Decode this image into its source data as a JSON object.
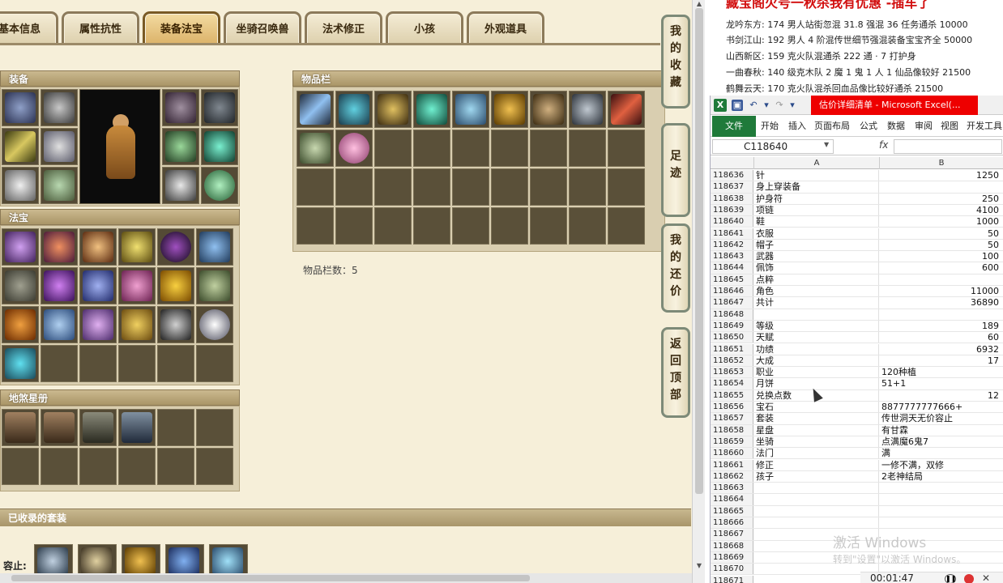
{
  "tabs": [
    {
      "label": "基本信息",
      "active": false
    },
    {
      "label": "属性抗性",
      "active": false
    },
    {
      "label": "装备法宝",
      "active": true
    },
    {
      "label": "坐骑召唤兽",
      "active": false
    },
    {
      "label": "法术修正",
      "active": false
    },
    {
      "label": "小孩",
      "active": false
    },
    {
      "label": "外观道具",
      "active": false
    }
  ],
  "panels": {
    "equipment": "装备",
    "treasure": "法宝",
    "star_album": "地煞星册",
    "inventory": "物品栏",
    "inventory_count": "物品栏数：5",
    "collected_sets": "已收录的套装",
    "contain_label": "容止:"
  },
  "side_buttons": [
    {
      "label": "我的收藏"
    },
    {
      "label": "足迹"
    },
    {
      "label": "我的还价"
    },
    {
      "label": "返回顶部"
    }
  ],
  "news": {
    "title": "藏宝阁火号一秋杀我有优惠 -插车了",
    "lines": [
      "龙吟东方: 174 男人站街忽混 31.8 强混 36 任务通杀 10000",
      "书剑江山: 192 男人 4 阶混传世细节强混装备宝宝齐全 50000",
      "山西新区: 159 克火队混通杀 222 通 · 7 打护身",
      "一曲春秋: 140 级克木队 2 魔 1 鬼 1 人 1 仙品像较好 21500",
      "鹤舞云天: 170 克火队混杀回血品像比较好通杀 21500"
    ]
  },
  "excel": {
    "logo": "X",
    "title": "估价详细清单 - Microsoft Excel(...",
    "ribbon_tabs": [
      "文件",
      "开始",
      "插入",
      "页面布局",
      "公式",
      "数据",
      "审阅",
      "视图",
      "开发工具"
    ],
    "name_box": "C118640",
    "fx": "fx",
    "columns": [
      "A",
      "B"
    ],
    "rows": [
      {
        "n": "118636",
        "a": "针",
        "b": "1250",
        "num": true
      },
      {
        "n": "118637",
        "a": "身上穿装备",
        "b": "",
        "num": false
      },
      {
        "n": "118638",
        "a": "护身符",
        "b": "250",
        "num": true
      },
      {
        "n": "118639",
        "a": "项链",
        "b": "4100",
        "num": true
      },
      {
        "n": "118640",
        "a": "鞋",
        "b": "1000",
        "num": true
      },
      {
        "n": "118641",
        "a": "衣服",
        "b": "50",
        "num": true
      },
      {
        "n": "118642",
        "a": "帽子",
        "b": "50",
        "num": true
      },
      {
        "n": "118643",
        "a": "武器",
        "b": "100",
        "num": true
      },
      {
        "n": "118644",
        "a": "佩饰",
        "b": "600",
        "num": true
      },
      {
        "n": "118645",
        "a": "点粹",
        "b": "",
        "num": false
      },
      {
        "n": "118646",
        "a": "角色",
        "b": "11000",
        "num": true
      },
      {
        "n": "118647",
        "a": "共计",
        "b": "36890",
        "num": true
      },
      {
        "n": "118648",
        "a": "",
        "b": "",
        "num": false
      },
      {
        "n": "118649",
        "a": "等级",
        "b": "189",
        "num": true
      },
      {
        "n": "118650",
        "a": "天赋",
        "b": "60",
        "num": true
      },
      {
        "n": "118651",
        "a": "功绩",
        "b": "6932",
        "num": true
      },
      {
        "n": "118652",
        "a": "大成",
        "b": "17",
        "num": true
      },
      {
        "n": "118653",
        "a": "职业",
        "b": "120种植",
        "num": false
      },
      {
        "n": "118654",
        "a": "月饼",
        "b": "51+1",
        "num": false
      },
      {
        "n": "118655",
        "a": "兑换点数",
        "b": "12",
        "num": true
      },
      {
        "n": "118656",
        "a": "宝石",
        "b": "8877777777666+",
        "num": false
      },
      {
        "n": "118657",
        "a": "套装",
        "b": "传世洞天无价容止",
        "num": false
      },
      {
        "n": "118658",
        "a": "星盘",
        "b": "有甘霖",
        "num": false
      },
      {
        "n": "118659",
        "a": "坐骑",
        "b": "点满魔6鬼7",
        "num": false
      },
      {
        "n": "118660",
        "a": "法门",
        "b": "满",
        "num": false
      },
      {
        "n": "118661",
        "a": "修正",
        "b": "一修不满，双修",
        "num": false
      },
      {
        "n": "118662",
        "a": "孩子",
        "b": "2老神结局",
        "num": false
      },
      {
        "n": "118663",
        "a": "",
        "b": "",
        "num": false
      },
      {
        "n": "118664",
        "a": "",
        "b": "",
        "num": false
      },
      {
        "n": "118665",
        "a": "",
        "b": "",
        "num": false
      },
      {
        "n": "118666",
        "a": "",
        "b": "",
        "num": false
      },
      {
        "n": "118667",
        "a": "",
        "b": "",
        "num": false
      },
      {
        "n": "118668",
        "a": "",
        "b": "",
        "num": false
      },
      {
        "n": "118669",
        "a": "",
        "b": "",
        "num": false
      },
      {
        "n": "118670",
        "a": "",
        "b": "",
        "num": false
      },
      {
        "n": "118671",
        "a": "",
        "b": "",
        "num": false
      }
    ]
  },
  "watermark": {
    "line1": "激活 Windows",
    "line2": "转到\"设置\"以激活 Windows。"
  },
  "recorder": {
    "time": "00:01:47",
    "close": "✕"
  },
  "colors": {
    "excel_green": "#1f7a3a",
    "title_red": "#e00000",
    "cell_brown": "#544a35"
  }
}
